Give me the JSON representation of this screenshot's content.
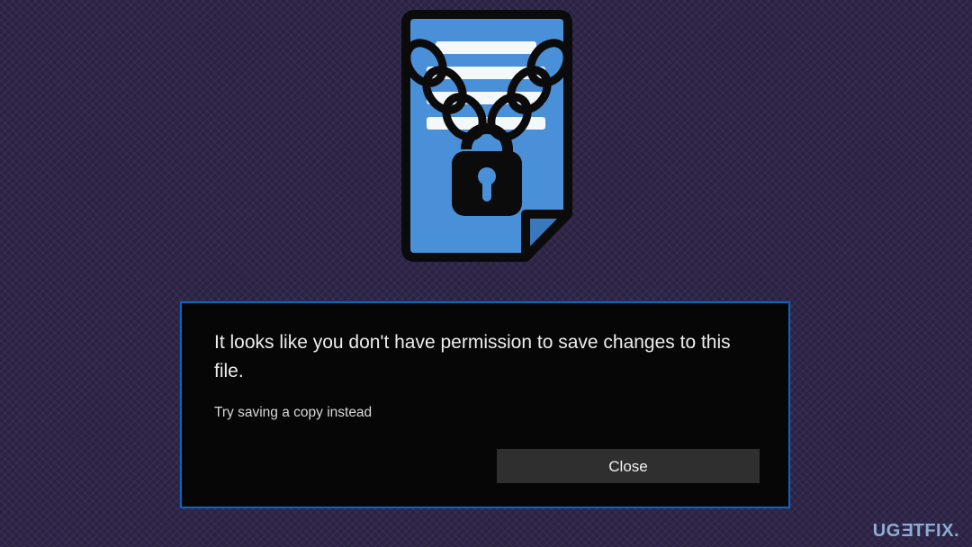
{
  "illustration": {
    "name": "locked-document"
  },
  "dialog": {
    "title": "It looks like you don't have permission to save changes to this file.",
    "subtitle": "Try saving a copy instead",
    "close_label": "Close"
  },
  "watermark": {
    "brand_pre": "UG",
    "brand_flip": "E",
    "brand_post": "TFIX."
  },
  "colors": {
    "accent": "#0a64c2",
    "doc": "#4a90d9",
    "bg": "#2a2340"
  }
}
